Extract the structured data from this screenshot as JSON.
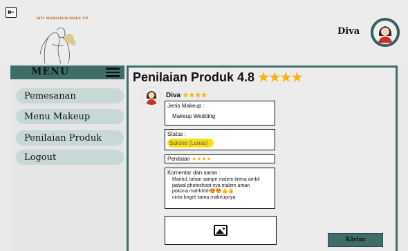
{
  "header": {
    "brand": "SITI MARIATUR MAKE UP",
    "user_name": "Diva"
  },
  "sidebar": {
    "menu_label": "MENU",
    "items": [
      {
        "label": "Pemesanan"
      },
      {
        "label": "Menu Makeup"
      },
      {
        "label": "Penilaian Produk"
      },
      {
        "label": "Logout"
      }
    ]
  },
  "main": {
    "title": "Penilaian Produk 4.8",
    "title_stars": "★★★★",
    "reviewer_name": "Diva",
    "reviewer_stars": "★★★★",
    "jenis_label": "Jenis Makeup :",
    "jenis_value": "Makeup Wedding",
    "status_label": "Status :",
    "status_value": "Sukses (Lunas)",
    "penilaian_label": "Penilaian",
    "penilaian_stars": "★★★★",
    "komentar_label": "Komentar dan saran :",
    "komentar_line1": "Mantul, tahan sampe malem krena ambil",
    "komentar_line2": "jadwal photoshoot nya malem aman",
    "komentar_line3": "pokona mahhhhh😍😍👍👍",
    "komentar_line4": "cinta bnget sama makeupnya",
    "send_label": "Kirim"
  },
  "colors": {
    "accent": "#3f6e6a",
    "nav_pill": "#c8d8d6",
    "star": "#f5b313",
    "status": "#f7df1c"
  }
}
